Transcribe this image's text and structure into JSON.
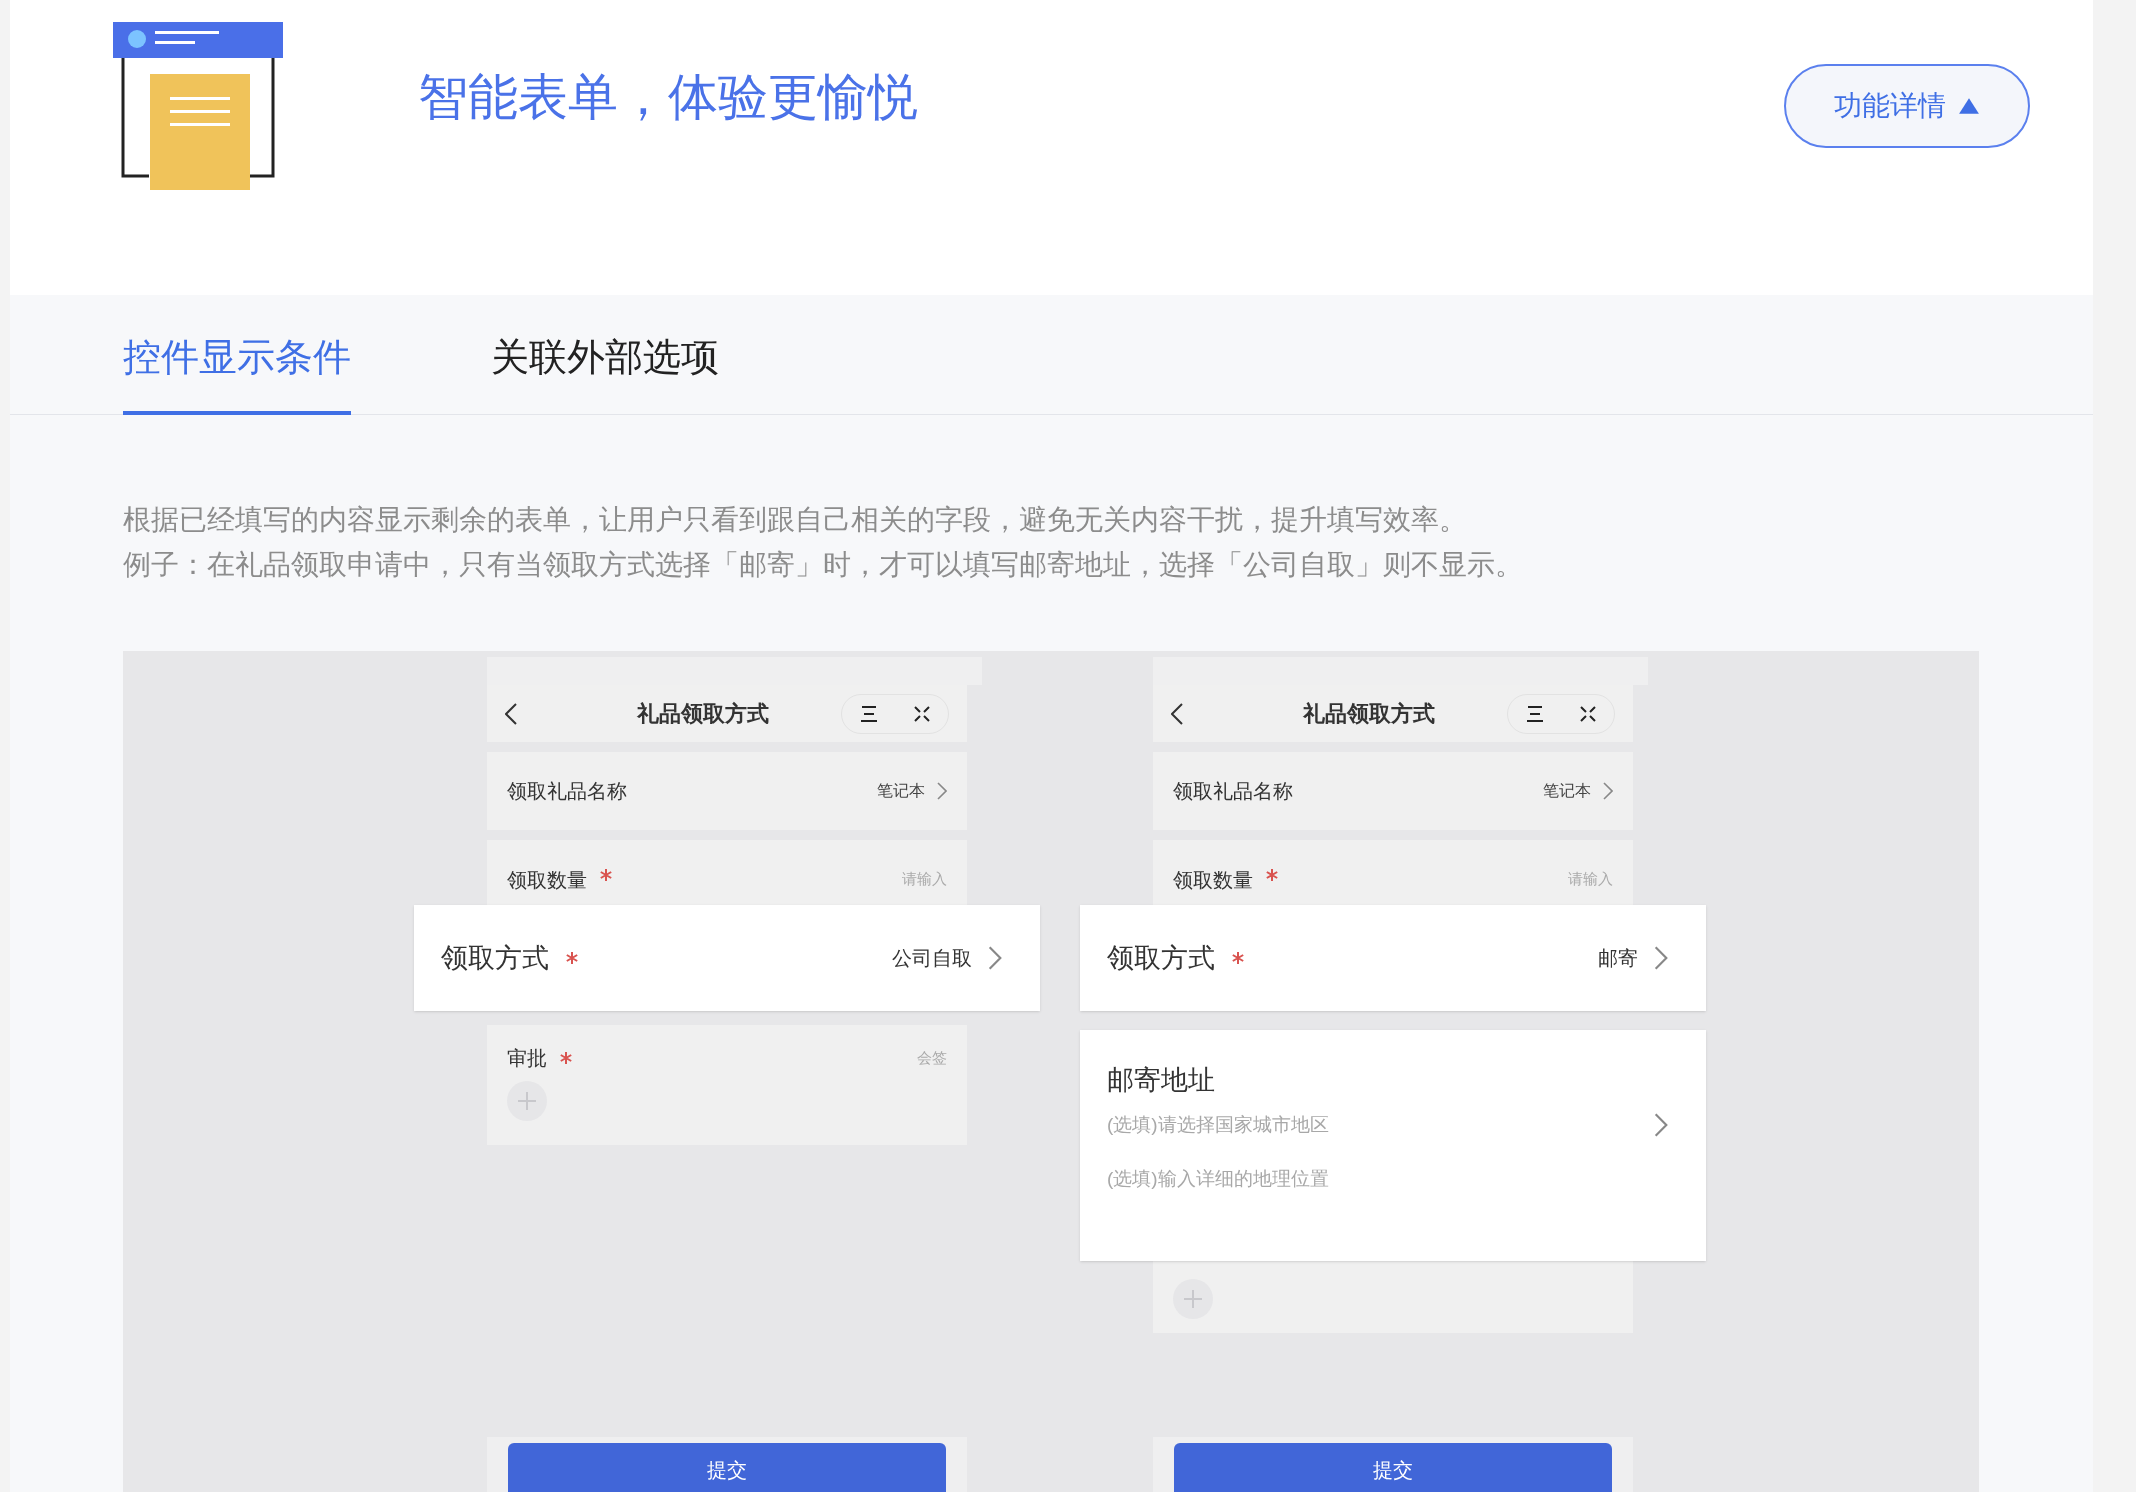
{
  "header": {
    "title": "智能表单，体验更愉悦",
    "details_button": {
      "label": "功能详情",
      "expanded": true
    }
  },
  "tabs": [
    {
      "label": "控件显示条件",
      "selected": true
    },
    {
      "label": "关联外部选项",
      "selected": false
    }
  ],
  "description": [
    "根据已经填写的内容显示剩余的表单，让用户只看到跟自己相关的字段，避免无关内容干扰，提升填写效率。",
    "例子：在礼品领取申请中，只有当领取方式选择「邮寄」时，才可以填写邮寄地址，选择「公司自取」则不显示。"
  ],
  "phones": [
    {
      "nav_title": "礼品领取方式",
      "submit": "提交",
      "fields": [
        {
          "kind": "select",
          "label": "领取礼品名称",
          "value": "笔记本",
          "required": false,
          "highlighted": false
        },
        {
          "kind": "input",
          "label": "领取数量",
          "placeholder": "请输入",
          "required": true,
          "highlighted": false
        },
        {
          "kind": "select",
          "label": "领取方式",
          "value": "公司自取",
          "required": true,
          "highlighted": true
        },
        {
          "kind": "approval",
          "label": "审批",
          "value": "会签",
          "required": true,
          "highlighted": false
        }
      ]
    },
    {
      "nav_title": "礼品领取方式",
      "submit": "提交",
      "fields": [
        {
          "kind": "select",
          "label": "领取礼品名称",
          "value": "笔记本",
          "required": false,
          "highlighted": false
        },
        {
          "kind": "input",
          "label": "领取数量",
          "placeholder": "请输入",
          "required": true,
          "highlighted": false
        },
        {
          "kind": "select",
          "label": "领取方式",
          "value": "邮寄",
          "required": true,
          "highlighted": true
        },
        {
          "kind": "address",
          "label": "邮寄地址",
          "placeholders": [
            "(选填)请选择国家城市地区",
            "(选填)输入详细的地理位置"
          ],
          "highlighted": true
        },
        {
          "kind": "approval"
        }
      ]
    }
  ]
}
